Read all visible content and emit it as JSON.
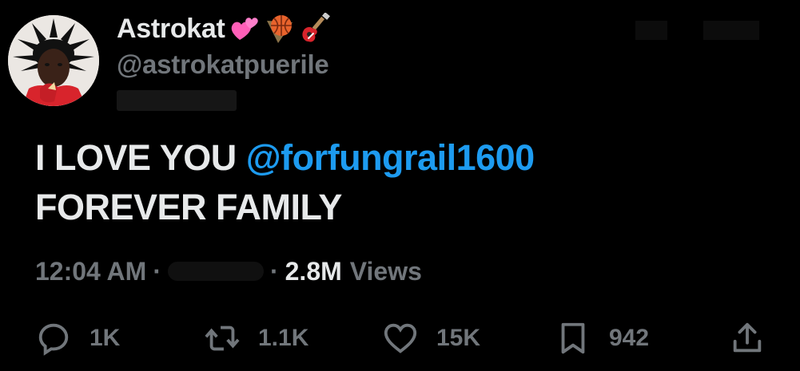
{
  "user": {
    "display_name": "Astrokat",
    "handle": "@astrokatpuerile",
    "emojis": [
      "two-hearts-icon",
      "basketball-icon",
      "guitar-icon"
    ]
  },
  "tweet": {
    "text_before_mention": "I LOVE YOU ",
    "mention": "@forfungrail1600",
    "text_line2": "FOREVER FAMILY"
  },
  "meta": {
    "time": "12:04 AM",
    "separator": "·",
    "views_count": "2.8M",
    "views_label": "Views"
  },
  "actions": {
    "replies": "1K",
    "retweets": "1.1K",
    "likes": "15K",
    "bookmarks": "942"
  },
  "colors": {
    "background": "#000000",
    "text": "#e7e9ea",
    "muted": "#71767b",
    "link": "#1d9bf0"
  }
}
